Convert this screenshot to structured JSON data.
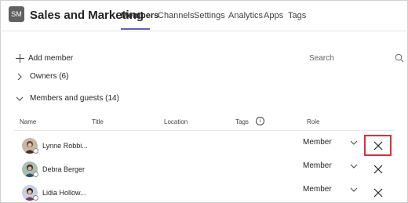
{
  "team": {
    "initials": "SM",
    "name": "Sales and Marketing"
  },
  "tabs": [
    {
      "label": "Members",
      "active": true
    },
    {
      "label": "Channels"
    },
    {
      "label": "Settings"
    },
    {
      "label": "Analytics"
    },
    {
      "label": "Apps"
    },
    {
      "label": "Tags"
    }
  ],
  "toolbar": {
    "add_member_label": "Add member",
    "search_placeholder": "Search"
  },
  "sections": {
    "owners": "Owners (6)",
    "members_guests": "Members and guests (14)"
  },
  "columns": {
    "name": "Name",
    "title": "Title",
    "location": "Location",
    "tags": "Tags",
    "tags_info_icon": "info-icon",
    "role": "Role"
  },
  "members": [
    {
      "name": "Lynne Robbi...",
      "role": "Member",
      "remove_highlighted": true
    },
    {
      "name": "Debra Berger",
      "role": "Member",
      "remove_highlighted": false
    },
    {
      "name": "Lidia Hollow...",
      "role": "Member",
      "remove_highlighted": false
    }
  ],
  "colors": {
    "accent": "#5b5fc7",
    "highlight_border": "#d13438",
    "team_avatar_bg": "#616161"
  }
}
